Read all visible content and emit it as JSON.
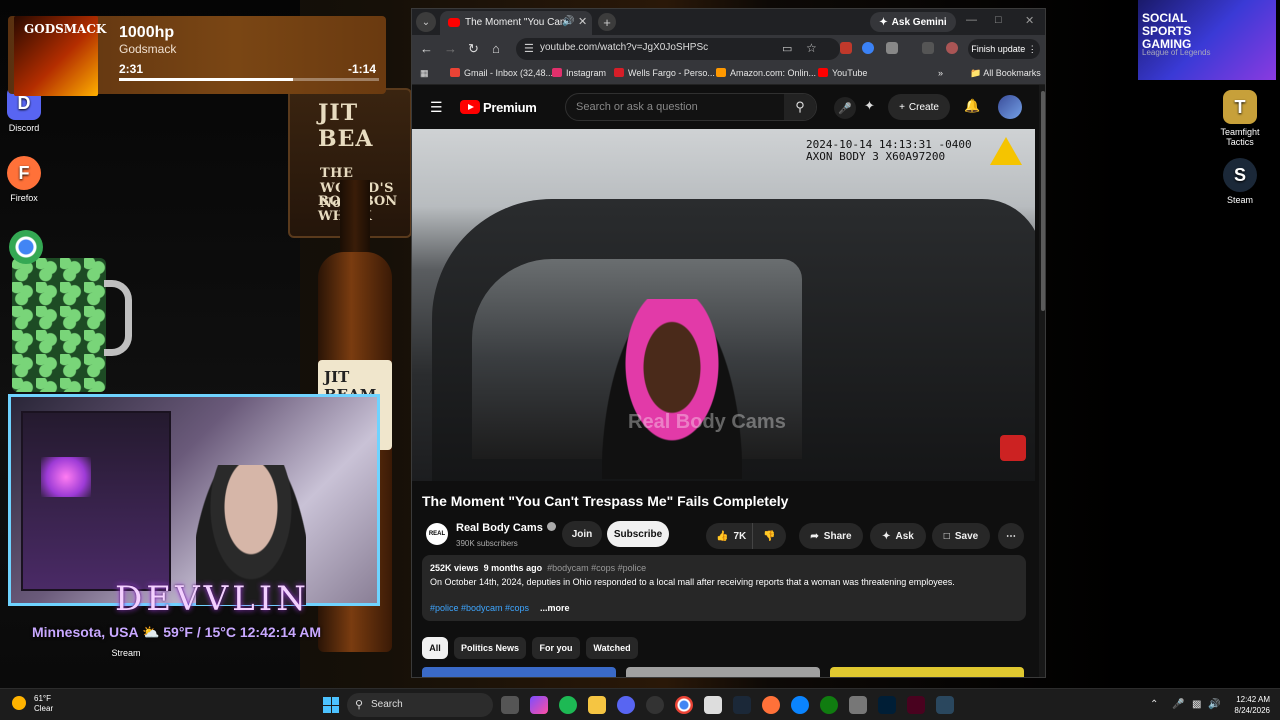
{
  "music": {
    "title": "1000hp",
    "artist": "Godsmack",
    "art_text": "GODSMACK",
    "elapsed": "2:31",
    "remaining": "-1:14",
    "progress": 0.67
  },
  "desktop": {
    "sign": [
      "JIT BEA",
      "THE WORLD'S No",
      "BOURBON WHISK"
    ],
    "bottle_label": "JIT BEAM",
    "icons": [
      {
        "label": "Discord",
        "color": "#5865F2",
        "glyph": "D"
      },
      {
        "label": "Firefox",
        "color": "#ff7139",
        "glyph": "F"
      },
      {
        "label": "Teamfight Tactics",
        "color": "#c7a03a",
        "glyph": "T"
      },
      {
        "label": "Steam",
        "color": "#1b2838",
        "glyph": "S"
      }
    ],
    "stream_label": "Stream",
    "promo": {
      "title": "SOCIAL SPORTS GAMING",
      "sub": "League of Legends"
    }
  },
  "overlay": {
    "brand": "DEVVLIN",
    "location": "Minnesota, USA",
    "temp": "59°F / 15°C",
    "time": "12:42:14 AM"
  },
  "browser": {
    "tab_title": "The Moment \"You Can't Tre",
    "ask_gemini": "Ask Gemini",
    "url": "youtube.com/watch?v=JgX0JoSHPSc",
    "finish_update": "Finish update",
    "bookmarks": [
      {
        "label": "Gmail - Inbox (32,48...",
        "color": "#ea4335"
      },
      {
        "label": "Instagram",
        "color": "#e1306c"
      },
      {
        "label": "Wells Fargo - Perso...",
        "color": "#d71e28"
      },
      {
        "label": "Amazon.com: Onlin...",
        "color": "#ff9900"
      },
      {
        "label": "YouTube",
        "color": "#ff0000"
      }
    ],
    "all_bookmarks": "All Bookmarks"
  },
  "youtube": {
    "logo": "Premium",
    "search_placeholder": "Search or ask a question",
    "create": "Create",
    "video": {
      "timestamp": "2024-10-14 14:13:31 -0400\nAXON BODY 3 X60A97200",
      "watermark": "Real Body Cams",
      "title": "The Moment \"You Can't Trespass Me\" Fails Completely"
    },
    "channel": {
      "avatar_text": "REAL",
      "name": "Real Body Cams",
      "subscribers": "390K subscribers",
      "join": "Join",
      "subscribe": "Subscribe"
    },
    "actions": {
      "likes": "7K",
      "share": "Share",
      "ask": "Ask",
      "save": "Save"
    },
    "description": {
      "views": "252K views",
      "age": "9 months ago",
      "tags": "#bodycam #cops #police",
      "text": "On October 14th, 2024, deputies in Ohio responded to a local mall after receiving reports that a woman was threatening employees.",
      "hashtags": "#police #bodycam #cops",
      "more": "...more"
    },
    "chips": [
      "All",
      "Politics News",
      "For you",
      "Watched"
    ]
  },
  "taskbar": {
    "weather_temp": "61°F",
    "weather_cond": "Clear",
    "search": "Search",
    "time": "12:42 AM",
    "date": "8/24/2026"
  },
  "colors": {
    "youtube_red": "#ff0000",
    "accent_blue": "#3ea6ff"
  }
}
